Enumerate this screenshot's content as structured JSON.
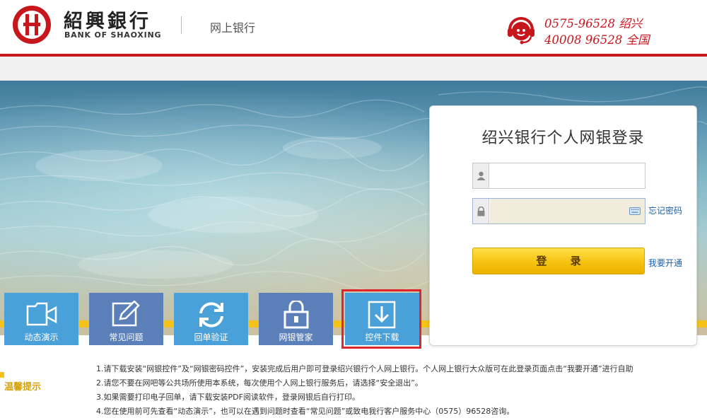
{
  "header": {
    "brand_cn": "紹興銀行",
    "brand_en": "BANK OF SHAOXING",
    "subtitle": "网上银行",
    "hotline_1": "0575-96528  绍兴",
    "hotline_2": "40008 96528 全国"
  },
  "login": {
    "title": "绍兴银行个人网银登录",
    "username_value": "",
    "password_value": "",
    "forgot_link": "忘记密码",
    "login_button": "登  录",
    "open_link": "我要开通"
  },
  "tiles": [
    {
      "label": "动态演示",
      "icon": "video-camera-icon"
    },
    {
      "label": "常见问题",
      "icon": "edit-pencil-icon"
    },
    {
      "label": "回单验证",
      "icon": "refresh-icon"
    },
    {
      "label": "网银管家",
      "icon": "lock-icon"
    },
    {
      "label": "控件下载",
      "icon": "download-icon"
    }
  ],
  "tips": {
    "label": "温馨提示",
    "items": [
      "1.请下载安装“网银控件”及“网银密码控件”，安装完成后用户即可登录绍兴银行个人网上银行。个人网上银行大众版可在此登录页面点击“我要开通”进行自助",
      "2.请您不要在网吧等公共场所使用本系统，每次使用个人网上银行服务后，请选择“安全退出”。",
      "3.如果需要打印电子回单，请下载安装PDF阅读软件，登录网银后自行打印。",
      "4.您在使用前可先查看“动态演示”，也可以在遇到问题时查看“常见问题”或致电我行客户服务中心（0575）96528咨询。"
    ]
  },
  "colors": {
    "brand_red": "#c8161d",
    "gold": "#f4c21a",
    "tile_blue": "#4aa0d8",
    "tile_navy": "#5b7fb8",
    "link_blue": "#1b5fa8"
  }
}
